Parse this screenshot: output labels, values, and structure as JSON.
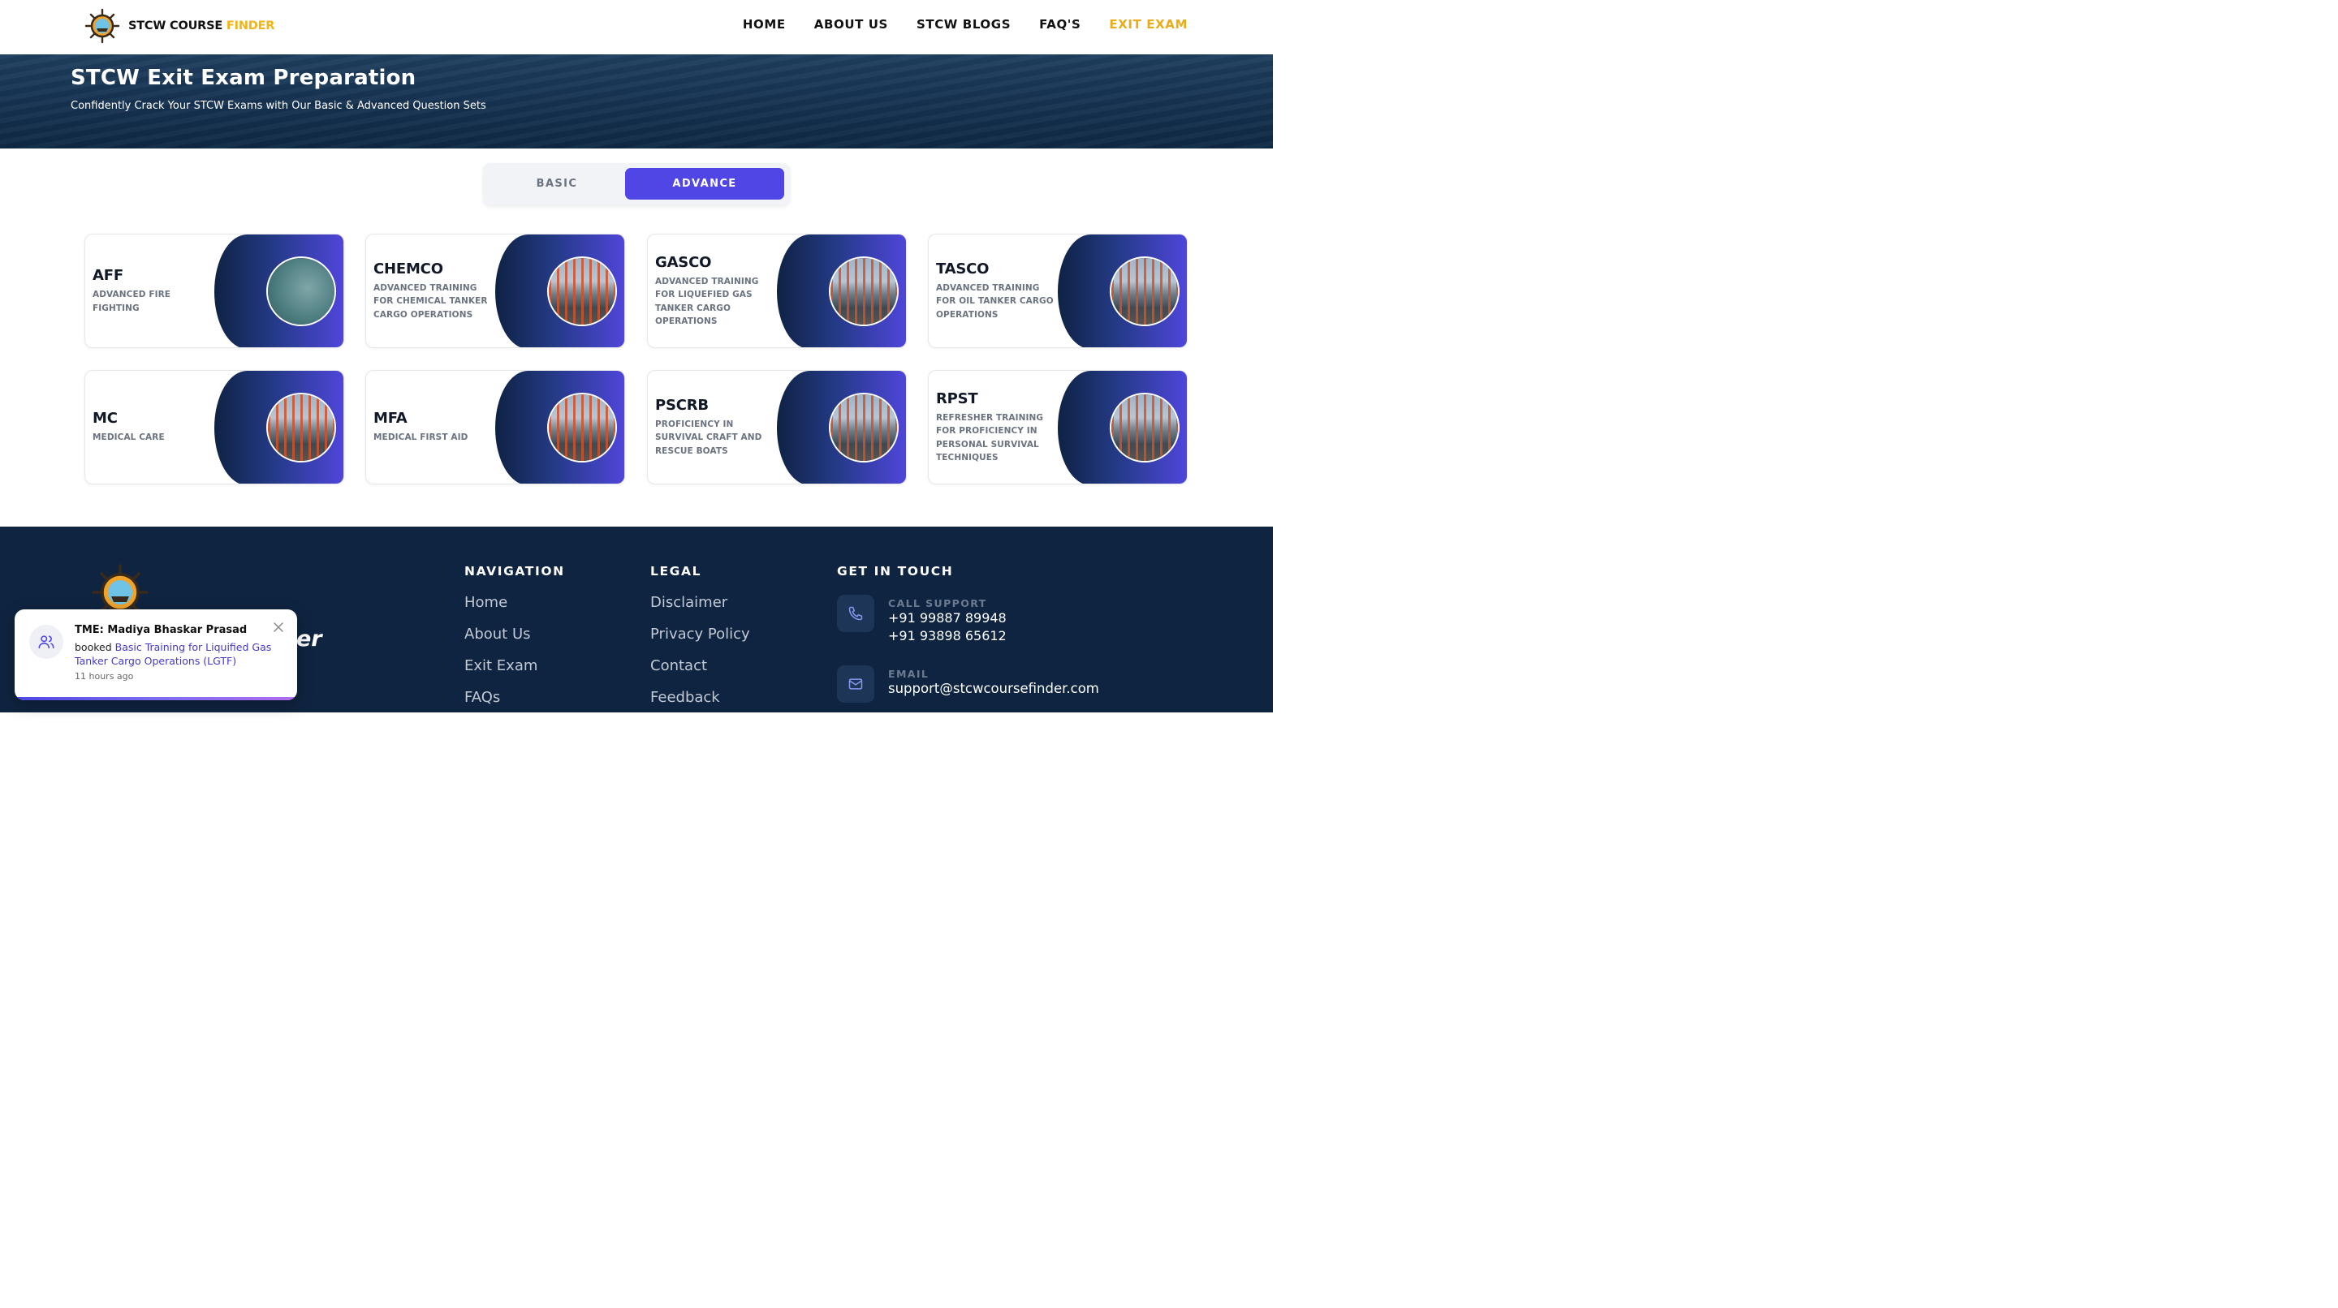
{
  "header": {
    "brand_primary": "STCW COURSE ",
    "brand_accent": "FINDER",
    "nav": [
      {
        "label": "HOME"
      },
      {
        "label": "ABOUT US"
      },
      {
        "label": "STCW BLOGS"
      },
      {
        "label": "FAQ'S"
      },
      {
        "label": "EXIT EXAM",
        "active": true
      }
    ]
  },
  "hero": {
    "title": "STCW Exit Exam Preparation",
    "subtitle": "Confidently Crack Your STCW Exams with Our Basic & Advanced Question Sets"
  },
  "toggle": {
    "basic_label": "BASIC",
    "advance_label": "ADVANCE",
    "selected": "ADVANCE"
  },
  "courses": [
    {
      "code": "AFF",
      "description": "ADVANCED FIRE FIGHTING",
      "image": "aff-photo"
    },
    {
      "code": "CHEMCO",
      "description": "ADVANCED TRAINING FOR CHEMICAL TANKER CARGO OPERATIONS",
      "image": "port-photo"
    },
    {
      "code": "GASCO",
      "description": "ADVANCED TRAINING FOR LIQUEFIED GAS TANKER CARGO OPERATIONS",
      "image": "port-photo"
    },
    {
      "code": "TASCO",
      "description": "ADVANCED TRAINING FOR OIL TANKER CARGO OPERATIONS",
      "image": "port-photo"
    },
    {
      "code": "MC",
      "description": "MEDICAL CARE",
      "image": "port-photo"
    },
    {
      "code": "MFA",
      "description": "MEDICAL FIRST AID",
      "image": "port-photo"
    },
    {
      "code": "PSCRB",
      "description": "PROFICIENCY IN SURVIVAL CRAFT AND RESCUE BOATS",
      "image": "port-photo"
    },
    {
      "code": "RPST",
      "description": "REFRESHER TRAINING FOR PROFICIENCY IN PERSONAL SURVIVAL TECHNIQUES",
      "image": "port-photo"
    }
  ],
  "footer": {
    "brand_partial": "er",
    "navigation": {
      "heading": "NAVIGATION",
      "links": [
        "Home",
        "About Us",
        "Exit Exam",
        "FAQs"
      ]
    },
    "legal": {
      "heading": "LEGAL",
      "links": [
        "Disclaimer",
        "Privacy Policy",
        "Contact",
        "Feedback"
      ]
    },
    "contact": {
      "heading": "GET IN TOUCH",
      "call_label": "CALL SUPPORT",
      "phones": [
        "+91 99887 89948",
        "+91 93898 65612"
      ],
      "email_label": "EMAIL",
      "email": "support@stcwcoursefinder.com"
    }
  },
  "toast": {
    "title": "TME: Madiya Bhaskar Prasad",
    "prefix": "booked ",
    "course": "Basic Training for Liquified Gas Tanker Cargo Operations (LGTF)",
    "time": "11 hours ago"
  },
  "colors": {
    "accent": "#4f46e5",
    "brand_gold": "#f2b416",
    "footer_bg": "#0f2440",
    "hero_bg": "#173453"
  }
}
